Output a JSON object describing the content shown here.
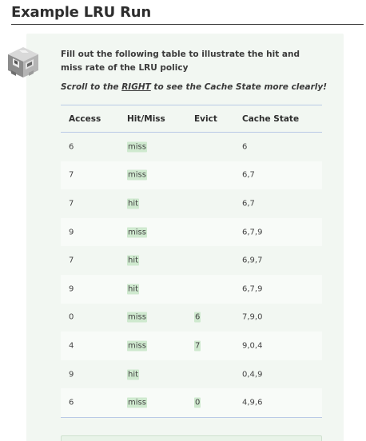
{
  "page": {
    "title": "Example LRU Run"
  },
  "exercise": {
    "instructions": "Fill out the following table to illustrate the hit and miss rate of the LRU policy",
    "scroll_prefix": "Scroll to the ",
    "scroll_emphasis": "RIGHT",
    "scroll_suffix": " to see the Cache State more clearly!"
  },
  "table": {
    "headers": {
      "access": "Access",
      "hitmiss": "Hit/Miss",
      "evict": "Evict",
      "cache": "Cache State"
    },
    "rows": [
      {
        "access": "6",
        "hitmiss": "miss",
        "evict": "",
        "cache": "6"
      },
      {
        "access": "7",
        "hitmiss": "miss",
        "evict": "",
        "cache": "6,7"
      },
      {
        "access": "7",
        "hitmiss": "hit",
        "evict": "",
        "cache": "6,7"
      },
      {
        "access": "9",
        "hitmiss": "miss",
        "evict": "",
        "cache": "6,7,9"
      },
      {
        "access": "7",
        "hitmiss": "hit",
        "evict": "",
        "cache": "6,9,7"
      },
      {
        "access": "9",
        "hitmiss": "hit",
        "evict": "",
        "cache": "6,7,9"
      },
      {
        "access": "0",
        "hitmiss": "miss",
        "evict": "6",
        "cache": "7,9,0"
      },
      {
        "access": "4",
        "hitmiss": "miss",
        "evict": "7",
        "cache": "9,0,4"
      },
      {
        "access": "9",
        "hitmiss": "hit",
        "evict": "",
        "cache": "0,4,9"
      },
      {
        "access": "6",
        "hitmiss": "miss",
        "evict": "0",
        "cache": "4,9,6"
      }
    ]
  },
  "colors": {
    "card_background": "#f2f7f2",
    "highlight": "#cfe9cf",
    "table_rule": "#b9c9e6"
  },
  "icons": {
    "mascot": "robot-mascot-icon"
  }
}
